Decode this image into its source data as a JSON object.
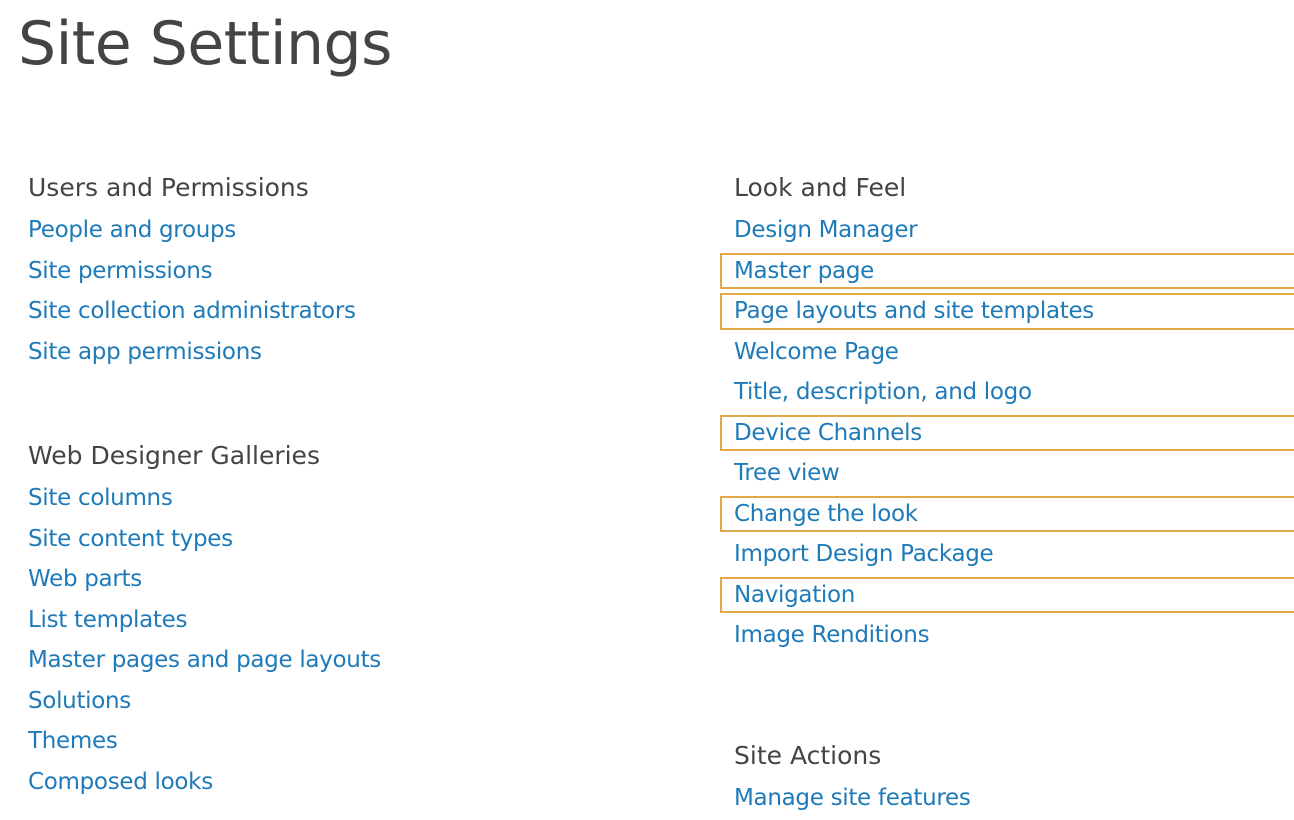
{
  "page": {
    "title": "Site Settings"
  },
  "colors": {
    "link": "#1e7ab8",
    "heading": "#444444",
    "highlight_border": "#e2a94a",
    "background": "#ffffff"
  },
  "left_column": {
    "users_and_permissions": {
      "heading": "Users and Permissions",
      "links": [
        "People and groups",
        "Site permissions",
        "Site collection administrators",
        "Site app permissions"
      ]
    },
    "web_designer_galleries": {
      "heading": "Web Designer Galleries",
      "links": [
        "Site columns",
        "Site content types",
        "Web parts",
        "List templates",
        "Master pages and page layouts",
        "Solutions",
        "Themes",
        "Composed looks"
      ]
    }
  },
  "right_column": {
    "look_and_feel": {
      "heading": "Look and Feel",
      "links": [
        "Design Manager",
        "Master page",
        "Page layouts and site templates",
        "Welcome Page",
        "Title, description, and logo",
        "Device Channels",
        "Tree view",
        "Change the look",
        "Import Design Package",
        "Navigation",
        "Image Renditions"
      ],
      "highlighted_links": [
        "Master page",
        "Page layouts and site templates",
        "Device Channels",
        "Change the look",
        "Navigation"
      ]
    },
    "site_actions": {
      "heading": "Site Actions",
      "links": [
        "Manage site features"
      ]
    }
  }
}
